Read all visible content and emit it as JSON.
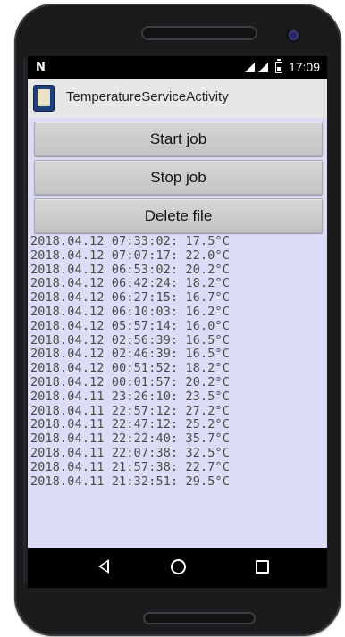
{
  "status_bar": {
    "notification_icon": "N",
    "icons": [
      "wifi-signal-icon",
      "cell-signal-icon",
      "battery-icon"
    ],
    "time": "17:09"
  },
  "action_bar": {
    "app_icon": "app-icon",
    "title": "TemperatureServiceActivity"
  },
  "buttons": {
    "start": "Start job",
    "stop": "Stop job",
    "delete": "Delete file"
  },
  "log_entries": [
    "2018.04.12 07:33:02: 17.5°C",
    "2018.04.12 07:07:17: 22.0°C",
    "2018.04.12 06:53:02: 20.2°C",
    "2018.04.12 06:42:24: 18.2°C",
    "2018.04.12 06:27:15: 16.7°C",
    "2018.04.12 06:10:03: 16.2°C",
    "2018.04.12 05:57:14: 16.0°C",
    "2018.04.12 02:56:39: 16.5°C",
    "2018.04.12 02:46:39: 16.5°C",
    "2018.04.12 00:51:52: 18.2°C",
    "2018.04.12 00:01:57: 20.2°C",
    "2018.04.11 23:26:10: 23.5°C",
    "2018.04.11 22:57:12: 27.2°C",
    "2018.04.11 22:47:12: 25.2°C",
    "2018.04.11 22:22:40: 35.7°C",
    "2018.04.11 22:07:38: 32.5°C",
    "2018.04.11 21:57:38: 22.7°C",
    "2018.04.11 21:32:51: 29.5°C"
  ],
  "nav_bar": {
    "back": "back-icon",
    "home": "home-icon",
    "recents": "recents-icon"
  },
  "colors": {
    "content_background": "#dcdcf6",
    "button_background": "#c9c9c9",
    "action_bar_background": "#e7e7e7"
  }
}
